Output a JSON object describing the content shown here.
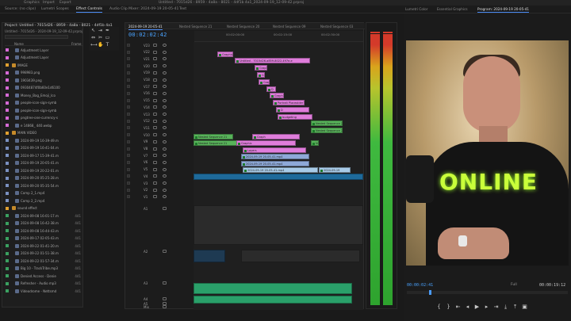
{
  "topbar": {
    "items": [
      "Graphics",
      "Import",
      "Export"
    ],
    "file_path": "Untitled - 7015d26 - 8959 - 4a8a - 8021 - 4df1b 4a1_2024-09-19_12-09-42.prproj"
  },
  "workspace_tabs": [
    "Source: (no clips)",
    "Lumetri Scopes",
    "Effect Controls",
    "Audio Clip Mixer: 2024-09-19 20-05-41",
    "Text",
    "Lumetri Color",
    "Essential Graphics",
    "Program: 2024-09-19 20-05-41"
  ],
  "project": {
    "title": "Project: Untitled - 7015d26 - 8959 - 4a8a - 8021 - 4df1b 4a1",
    "file": "Untitled - 7015d26 - 2024-09-19_12-09-42.prproj",
    "col_name": "Name",
    "col_frame": "Frame",
    "items": [
      {
        "name": "Adjustment Layer",
        "frame": "",
        "color": "#d66ad6",
        "type": "file"
      },
      {
        "name": "Adjustment Layer",
        "frame": "",
        "color": "#d66ad6",
        "type": "file"
      },
      {
        "name": "IMAGE",
        "frame": "",
        "color": "#e0a030",
        "type": "folder"
      },
      {
        "name": "998983.png",
        "frame": "",
        "color": "#d66ad6",
        "type": "file"
      },
      {
        "name": "1903439.png",
        "frame": "",
        "color": "#d66ad6",
        "type": "file"
      },
      {
        "name": "09304874f0b60e1d6100",
        "frame": "",
        "color": "#d66ad6",
        "type": "file"
      },
      {
        "name": "Money_Bag_Emoji_Ico",
        "frame": "",
        "color": "#d66ad6",
        "type": "file"
      },
      {
        "name": "people-icon-sign-symb",
        "frame": "",
        "color": "#d66ad6",
        "type": "file"
      },
      {
        "name": "people-icon-sign-symb",
        "frame": "",
        "color": "#d66ad6",
        "type": "file"
      },
      {
        "name": "pngtree-one-currency-s",
        "frame": "",
        "color": "#d66ad6",
        "type": "file"
      },
      {
        "name": "e 14868_ 440.webp",
        "frame": "",
        "color": "#d66ad6",
        "type": "file"
      },
      {
        "name": "MAIN VIDEO",
        "frame": "",
        "color": "#e0a030",
        "type": "folder"
      },
      {
        "name": "2024-09-19 16-39-49.m",
        "frame": "",
        "color": "#7a90c0",
        "type": "file"
      },
      {
        "name": "2024-09-19 16-41-04.m",
        "frame": "",
        "color": "#7a90c0",
        "type": "file"
      },
      {
        "name": "2024-09-17 15-39-41.m",
        "frame": "",
        "color": "#7a90c0",
        "type": "file"
      },
      {
        "name": "2024-09-19 20-05-41.m",
        "frame": "",
        "color": "#7a90c0",
        "type": "file"
      },
      {
        "name": "2024-09-19 20-22-01.m",
        "frame": "",
        "color": "#7a90c0",
        "type": "file"
      },
      {
        "name": "2024-09-20 05-25-28.m",
        "frame": "",
        "color": "#7a90c0",
        "type": "file"
      },
      {
        "name": "2024-09-20 05-35-54.m",
        "frame": "",
        "color": "#7a90c0",
        "type": "file"
      },
      {
        "name": "Comp 2_1.mp4",
        "frame": "",
        "color": "#7a90c0",
        "type": "file"
      },
      {
        "name": "Comp 2_2.mp4",
        "frame": "",
        "color": "#7a90c0",
        "type": "file"
      },
      {
        "name": "sound effect",
        "frame": "",
        "color": "#e0a030",
        "type": "folder"
      },
      {
        "name": "2024-09-08 16-01-17.m",
        "frame": "441",
        "color": "#3aa060",
        "type": "file"
      },
      {
        "name": "2024-09-08 16-42-38.m",
        "frame": "441",
        "color": "#3aa060",
        "type": "file"
      },
      {
        "name": "2024-09-08 16-44-43.m",
        "frame": "441",
        "color": "#3aa060",
        "type": "file"
      },
      {
        "name": "2024-09-17 02-05-43.m",
        "frame": "441",
        "color": "#3aa060",
        "type": "file"
      },
      {
        "name": "2024-09-22 01-41-20.m",
        "frame": "441",
        "color": "#3aa060",
        "type": "file"
      },
      {
        "name": "2024-09-22 01-51-38.m",
        "frame": "441",
        "color": "#3aa060",
        "type": "file"
      },
      {
        "name": "2024-09-22 01-57-34.m",
        "frame": "441",
        "color": "#3aa060",
        "type": "file"
      },
      {
        "name": "Big 10 - TrackTribe.mp3",
        "frame": "441",
        "color": "#3aa060",
        "type": "file"
      },
      {
        "name": "Denied Access - Denie",
        "frame": "441",
        "color": "#3aa060",
        "type": "file"
      },
      {
        "name": "Refresher - Audio mp3",
        "frame": "441",
        "color": "#3aa060",
        "type": "file"
      },
      {
        "name": "Videodrome - Nettsmd",
        "frame": "441",
        "color": "#3aa060",
        "type": "file"
      }
    ]
  },
  "timeline": {
    "tabs": [
      "2024-09-19 20-05-41",
      "Nested Sequence 21",
      "Nested Sequence 20",
      "Nested Sequence 09",
      "Nested Sequence 03"
    ],
    "timecode": "00:02:02:42",
    "ruler": [
      "00:02:00:00",
      "00:02:15:00",
      "00:02:30:00"
    ],
    "video_tracks": [
      "V23",
      "V22",
      "V21",
      "V20",
      "V19",
      "V18",
      "V17",
      "V16",
      "V15",
      "V14",
      "V13",
      "V12",
      "V11",
      "V10",
      "V9",
      "V8",
      "V7",
      "V6",
      "V5",
      "V4",
      "V3",
      "V2",
      "V1"
    ],
    "audio_tracks": [
      "A1",
      "A2",
      "A3",
      "A4",
      "A5",
      "Mix"
    ],
    "clips": [
      {
        "label": "Graphic",
        "color": "pink"
      },
      {
        "label": "Untitled - 7015d26-a859-8022-497e-e",
        "color": "pink"
      },
      {
        "label": "Graphic",
        "color": "pink"
      },
      {
        "label": "Graphic",
        "color": "pink"
      },
      {
        "label": "Graphic",
        "color": "pink"
      },
      {
        "label": "D",
        "color": "pink"
      },
      {
        "label": "Graphic",
        "color": "pink"
      },
      {
        "label": "Portrait Placeolder",
        "color": "pink"
      },
      {
        "label": "D",
        "color": "pink"
      },
      {
        "label": "budgeting",
        "color": "pink"
      },
      {
        "label": "Nested Sequence 23",
        "color": "green"
      },
      {
        "label": "Nested Sequence 22",
        "color": "green"
      },
      {
        "label": "Nested Sequence 21",
        "color": "green"
      },
      {
        "label": "Graph",
        "color": "pink"
      },
      {
        "label": "Nested Sequence 21",
        "color": "green"
      },
      {
        "label": "Graphic",
        "color": "pink"
      },
      {
        "label": "Nested Sequence 20",
        "color": "green"
      },
      {
        "label": "Layers",
        "color": "pink"
      },
      {
        "label": "2024-09-19 20-05-41.mp4",
        "color": "blue"
      },
      {
        "label": "2024-09-19 20-05-41.mp4",
        "color": "blue"
      },
      {
        "label": "2024-09-19",
        "color": "ltblue"
      },
      {
        "label": "2024-09-19 20-05-41.mp4",
        "color": "ltblue"
      }
    ]
  },
  "meters": {
    "peak_color": "#d43a2a"
  },
  "program": {
    "tabs": [
      "Lumetri Color",
      "Essential Graphics",
      "Program: 2024-09-19 20-05-41"
    ],
    "overlay_text": "ONLINE",
    "timecode": "00:00:02:41",
    "fit": "Full",
    "duration": "00:00:19:12",
    "accent_color": "#c9ff3a"
  }
}
